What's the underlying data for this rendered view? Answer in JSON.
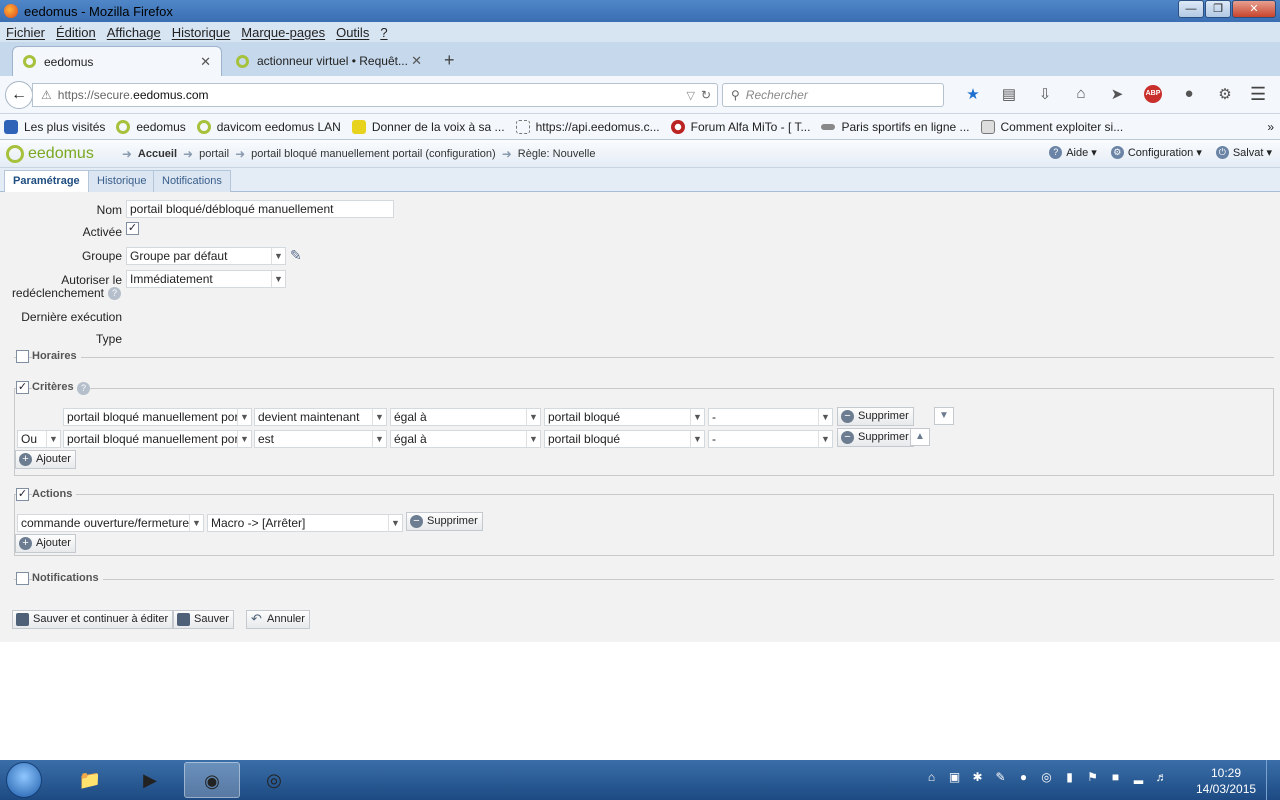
{
  "window": {
    "title": "eedomus - Mozilla Firefox"
  },
  "menubar": [
    "Fichier",
    "Édition",
    "Affichage",
    "Historique",
    "Marque-pages",
    "Outils",
    "?"
  ],
  "browser_tabs": [
    {
      "label": "eedomus"
    },
    {
      "label": "actionneur virtuel • Requêt..."
    }
  ],
  "nav": {
    "url_prefix": "https://secure.",
    "url_domain": "eedomus.com",
    "search_placeholder": "Rechercher"
  },
  "bookmarks": [
    "Les plus visités",
    "eedomus",
    "davicom eedomus LAN",
    "Donner de la voix à sa ...",
    "https://api.eedomus.c...",
    "Forum Alfa MiTo - [ T...",
    "Paris sportifs en ligne ...",
    "Comment exploiter si..."
  ],
  "app": {
    "logo": "eedomus",
    "breadcrumb": [
      "Accueil",
      "portail",
      "portail bloqué manuellement portail (configuration)",
      "Règle: Nouvelle"
    ],
    "header_right": {
      "help": "Aide",
      "config": "Configuration",
      "user": "Salvat"
    },
    "tabs": [
      "Paramétrage",
      "Historique",
      "Notifications"
    ]
  },
  "form": {
    "nom_label": "Nom",
    "nom_value": "portail bloqué/débloqué manuellement",
    "activee_label": "Activée",
    "groupe_label": "Groupe",
    "groupe_value": "Groupe par défaut",
    "autoriser_label_1": "Autoriser le",
    "autoriser_label_2": "redéclenchement",
    "autoriser_value": "Immédiatement",
    "derniere_label": "Dernière exécution",
    "type_label": "Type"
  },
  "sections": {
    "horaires": "Horaires",
    "criteres": "Critères",
    "actions": "Actions",
    "notifications": "Notifications"
  },
  "criteria": [
    {
      "connector": "",
      "device": "portail bloqué manuellement portail",
      "condition": "devient maintenant",
      "operator": "égal à",
      "value": "portail bloqué",
      "extra": "-",
      "delete": "Supprimer"
    },
    {
      "connector": "Ou",
      "device": "portail bloqué manuellement portail",
      "condition": "est",
      "operator": "égal à",
      "value": "portail bloqué",
      "extra": "-",
      "delete": "Supprimer"
    }
  ],
  "actions": [
    {
      "device": "commande ouverture/fermeture pc",
      "value": "Macro -> [Arrêter]",
      "delete": "Supprimer"
    }
  ],
  "buttons": {
    "add": "Ajouter",
    "save_continue": "Sauver et continuer à éditer",
    "save": "Sauver",
    "cancel": "Annuler"
  },
  "taskbar": {
    "time": "10:29",
    "date": "14/03/2015"
  }
}
